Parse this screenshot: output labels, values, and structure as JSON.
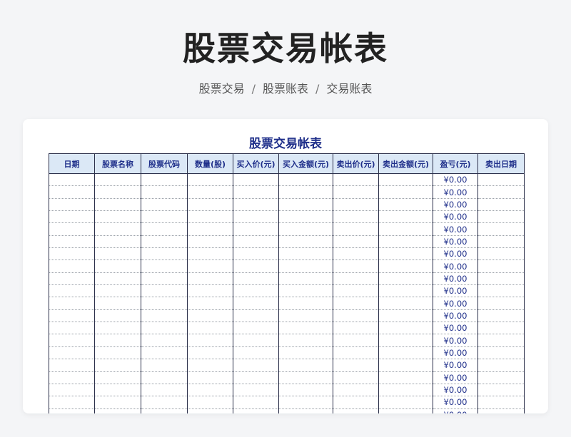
{
  "page": {
    "title": "股票交易帐表",
    "breadcrumb": [
      "股票交易",
      "股票账表",
      "交易账表"
    ]
  },
  "sheet": {
    "title": "股票交易帐表",
    "columns": [
      "日期",
      "股票名称",
      "股票代码",
      "数量(股)",
      "买入价(元)",
      "买入金额(元)",
      "卖出价(元)",
      "卖出金额(元)",
      "盈亏(元)",
      "卖出日期"
    ],
    "profit_value": "¥0.00",
    "row_count": 20
  }
}
